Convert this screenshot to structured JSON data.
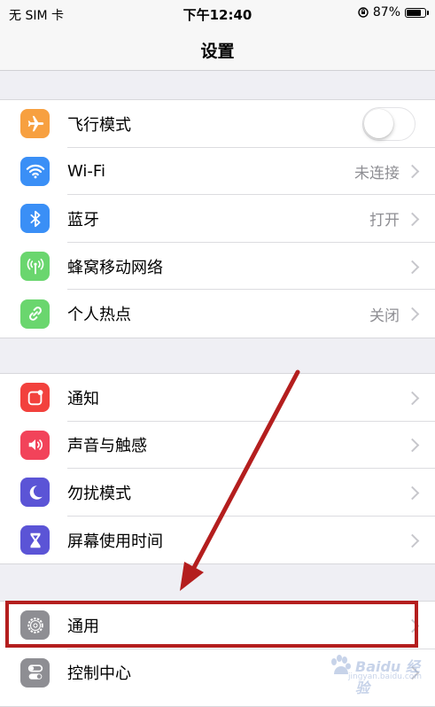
{
  "status_bar": {
    "carrier": "无 SIM 卡",
    "time": "下午12:40",
    "battery": "87%",
    "battery_level": 0.87
  },
  "nav": {
    "title": "设置"
  },
  "groups": [
    {
      "items": [
        {
          "label": "飞行模式",
          "icon": "airplane-icon",
          "color": "#f7a040",
          "control": "toggle",
          "toggle_on": false
        },
        {
          "label": "Wi-Fi",
          "icon": "wifi-icon",
          "color": "#3a8ff6",
          "value": "未连接"
        },
        {
          "label": "蓝牙",
          "icon": "bluetooth-icon",
          "color": "#3a8ff6",
          "value": "打开"
        },
        {
          "label": "蜂窝移动网络",
          "icon": "cellular-icon",
          "color": "#6ad66e"
        },
        {
          "label": "个人热点",
          "icon": "hotspot-icon",
          "color": "#6ad66e",
          "value": "关闭"
        }
      ]
    },
    {
      "items": [
        {
          "label": "通知",
          "icon": "notifications-icon",
          "color": "#f2413d"
        },
        {
          "label": "声音与触感",
          "icon": "sound-icon",
          "color": "#f2435a"
        },
        {
          "label": "勿扰模式",
          "icon": "moon-icon",
          "color": "#5b54d6"
        },
        {
          "label": "屏幕使用时间",
          "icon": "hourglass-icon",
          "color": "#5b54d6"
        }
      ]
    },
    {
      "items": [
        {
          "label": "通用",
          "icon": "gear-icon",
          "color": "#8e8e93"
        },
        {
          "label": "控制中心",
          "icon": "control-center-icon",
          "color": "#8e8e93"
        }
      ]
    }
  ],
  "annotation": {
    "color": "#b41e1e"
  },
  "watermark": {
    "text": "Baidu 经验",
    "sub": "jingyan.baidu.com"
  }
}
